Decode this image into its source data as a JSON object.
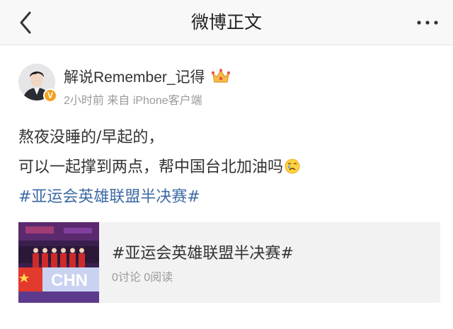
{
  "navbar": {
    "title": "微博正文"
  },
  "author": {
    "username": "解说Remember_记得",
    "verified_mark": "V",
    "time": "2小时前",
    "source_prefix": "来自",
    "source": "iPhone客户端"
  },
  "post": {
    "lines": [
      "熬夜没睡的/早起的，",
      "可以一起撑到两点，帮中国台北加油吗"
    ],
    "emoji": "crying-face-emoji",
    "hashtag": "#亚运会英雄联盟半决赛#"
  },
  "topic_card": {
    "title": "#亚运会英雄联盟半决赛#",
    "thumbnail_text": "CHN",
    "discussions": "0讨论",
    "reads": "0阅读"
  },
  "colors": {
    "link": "#3e6aa3",
    "meta": "#9a9a9a",
    "badge": "#f3a11d",
    "card_bg": "#f2f2f2"
  }
}
